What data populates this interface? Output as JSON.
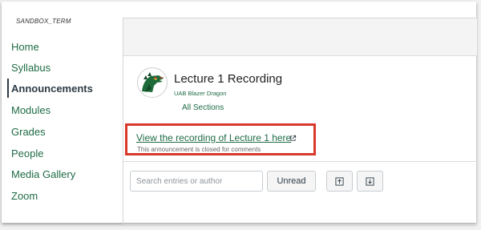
{
  "sidebar": {
    "term": "SANDBOX_TERM",
    "items": [
      {
        "label": "Home"
      },
      {
        "label": "Syllabus"
      },
      {
        "label": "Announcements"
      },
      {
        "label": "Modules"
      },
      {
        "label": "Grades"
      },
      {
        "label": "People"
      },
      {
        "label": "Media Gallery"
      },
      {
        "label": "Zoom"
      }
    ],
    "active_item": "Announcements"
  },
  "announcement": {
    "title": "Lecture 1 Recording",
    "author": "UAB Blazer Dragon",
    "sections": "All Sections",
    "link_text": "View the recording of Lecture 1 here",
    "closed_note": "This announcement is closed for comments",
    "external_icon": "external-link-icon"
  },
  "toolbar": {
    "search_placeholder": "Search entries or author",
    "unread_label": "Unread",
    "collapse_icon": "collapse-all-icon",
    "expand_icon": "expand-all-icon"
  },
  "colors": {
    "link_green": "#1f6b45",
    "highlight_red": "#d8392b",
    "text_dark": "#2d3b45"
  }
}
